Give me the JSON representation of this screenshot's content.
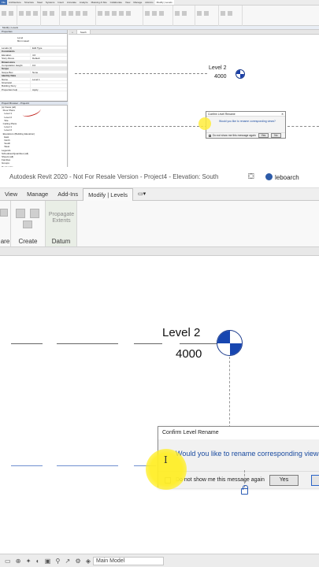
{
  "top": {
    "tabs": [
      "File",
      "Architecture",
      "Structure",
      "Steel",
      "Systems",
      "Insert",
      "Annotate",
      "Analyze",
      "Massing & Site",
      "Collaborate",
      "View",
      "Manage",
      "Add-Ins",
      "Modify | Levels"
    ],
    "modify_line": "Modify | Levels",
    "props": {
      "header": "Properties",
      "type_lines": [
        "Level",
        "8mm Head"
      ],
      "sel": "Levels (1)",
      "edit_type": "Edit Type",
      "rows": [
        {
          "k": "Constraints",
          "v": "",
          "sec": true
        },
        {
          "k": "Elevation",
          "v": "4.0"
        },
        {
          "k": "Story Above",
          "v": "Default"
        },
        {
          "k": "Dimensions",
          "v": "",
          "sec": true
        },
        {
          "k": "Computation Height",
          "v": "0.0"
        },
        {
          "k": "Scope",
          "v": "",
          "sec": true
        },
        {
          "k": "Scope Box",
          "v": "None"
        },
        {
          "k": "Identity Data",
          "v": "",
          "sec": true
        },
        {
          "k": "Name",
          "v": "Level 1"
        },
        {
          "k": "Structural",
          "v": ""
        },
        {
          "k": "Building Story",
          "v": ""
        }
      ],
      "help": "Properties help",
      "apply": "Apply"
    },
    "browser": {
      "header": "Project Browser - Project4",
      "nodes": [
        "[o] Views (all)",
        "  Floor Plans",
        "    Level 1",
        "    Level 2",
        "    Site",
        "  Ceiling Plans",
        "    Level 1",
        "    Level 2",
        "  Elevations (Building Elevation)",
        "    East",
        "    North",
        "    South",
        "    West",
        "Legends",
        "Schedules/Quantities (all)",
        "Sheets (all)",
        "Families",
        "Groups",
        "Revit Links"
      ]
    },
    "view_tab": "South",
    "level_name": "Level 2",
    "level_elev": "4000",
    "dialog": {
      "title": "Confirm Level Rename",
      "question": "Would you like to rename corresponding views?",
      "checkbox": "Do not show me this message again",
      "yes": "Yes",
      "no": "No"
    }
  },
  "mid": {
    "title": "Autodesk Revit 2020 - Not For Resale Version - Project4 - Elevation: South",
    "user": "leboarch",
    "tabs": [
      "View",
      "Manage",
      "Add-Ins",
      "Modify | Levels"
    ],
    "active_tab": "Modify | Levels",
    "groups": {
      "create": "Create",
      "datum": "Datum",
      "prev": "are",
      "propagate": "Propagate Extents"
    }
  },
  "low": {
    "level_name": "Level 2",
    "level_elev": "4000",
    "dialog": {
      "title": "Confirm Level Rename",
      "question": "Would you like to rename corresponding views?",
      "checkbox": "Do not show me this message again",
      "yes": "Yes",
      "no": "No"
    }
  },
  "status": {
    "model": "Main Model"
  }
}
